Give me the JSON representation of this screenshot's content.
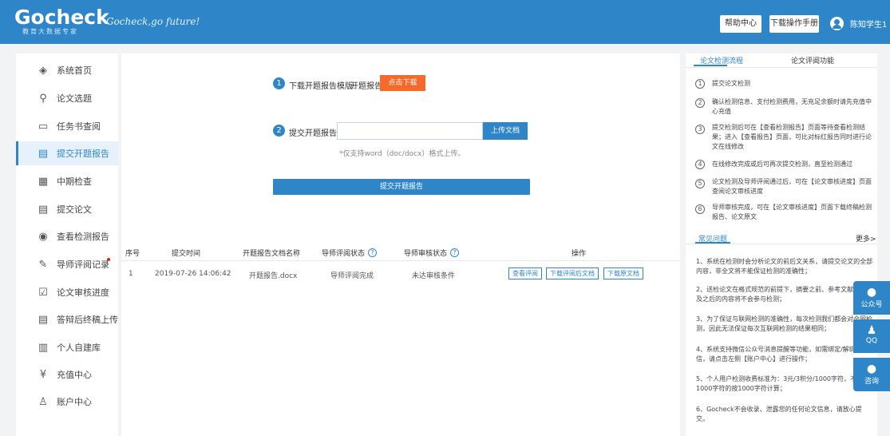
{
  "header": {
    "logo": "Gocheck",
    "logo_sub": "教育大数据专家",
    "slogan": "Gocheck,go future!",
    "help_label": "帮助中心",
    "manual_label": "下载操作手册",
    "user_name": "陈知学生1"
  },
  "sidebar": {
    "items": [
      {
        "label": "系统首页",
        "icon": "layers-icon",
        "glyph": "◈"
      },
      {
        "label": "论文选题",
        "icon": "search-icon",
        "glyph": "⚲"
      },
      {
        "label": "任务书查阅",
        "icon": "report-icon",
        "glyph": "▭"
      },
      {
        "label": "提交开题报告",
        "icon": "document-edit-icon",
        "glyph": "▤"
      },
      {
        "label": "中期检查",
        "icon": "table-icon",
        "glyph": "▦"
      },
      {
        "label": "提交论文",
        "icon": "document-submit-icon",
        "glyph": "▤"
      },
      {
        "label": "查看检测报告",
        "icon": "eye-icon",
        "glyph": "◉"
      },
      {
        "label": "导师评阅记录",
        "icon": "edit-icon",
        "glyph": "✎"
      },
      {
        "label": "论文审核进度",
        "icon": "clipboard-check-icon",
        "glyph": "☑"
      },
      {
        "label": "答辩后终稿上传",
        "icon": "document-upload-icon",
        "glyph": "▤"
      },
      {
        "label": "个人自建库",
        "icon": "library-icon",
        "glyph": "▥"
      },
      {
        "label": "充值中心",
        "icon": "yen-icon",
        "glyph": "¥"
      },
      {
        "label": "账户中心",
        "icon": "user-icon",
        "glyph": "♙"
      }
    ],
    "active_index": 3
  },
  "main": {
    "step1_num": "1",
    "step1_label": "下载开题报告模版:",
    "step1_file": "开题报告",
    "download_btn": "点击下载",
    "step2_num": "2",
    "step2_label": "提交开题报告:",
    "upload_btn": "上传文档",
    "hint": "*仅支持word（doc/docx）格式上传。",
    "submit_btn": "提交开题报告",
    "table": {
      "headers": [
        "序号",
        "提交时间",
        "开题报告文档名称",
        "导师评阅状态",
        "导师审核状态",
        "操作"
      ],
      "rows": [
        {
          "index": "1",
          "time": "2019-07-26 14:06:42",
          "name": "开题报告.docx",
          "review_status": "导师评阅完成",
          "audit_status": "未达审核条件",
          "actions": [
            "查看评阅",
            "下载评阅后文档",
            "下载原文档"
          ]
        }
      ]
    }
  },
  "right_panel": {
    "tabs": [
      "论文检测流程",
      "论文评阅功能"
    ],
    "active_tab": 0,
    "flow": [
      {
        "num": "1",
        "text": "提交论文检测"
      },
      {
        "num": "2",
        "text": "确认检测信息、支付检测费用，无充足余额时请先充值中心充值"
      },
      {
        "num": "3",
        "text": "提交检测后可在【查看检测报告】页面等待查看检测结果；进入【查看报告】页面，可比对标红报告同时进行论文在线修改"
      },
      {
        "num": "4",
        "text": "在线修改完成或后可再次提交检测，直至检测通过"
      },
      {
        "num": "5",
        "text": "论文检测及导师评阅通过后，可在【论文审核进度】页面查阅论文审核进度"
      },
      {
        "num": "6",
        "text": "导师审核完成，可在【论文审核进度】页面下载终稿检测报告、论文原文"
      }
    ],
    "faq_title": "常见问题",
    "more": "更多>",
    "faq": [
      "1、系统在检测时会分析论文的前后文关系，请提交论文的全部内容，非全文将不能保证检测的准确性；",
      "2、送检论文在格式规范的前提下，摘要之前、参考文献（含）及之后的内容将不会参与检测；",
      "3、为了保证与联网检测的准确性，每次检测我们都会对全网检测，因此无法保证每次互联网检测的结果相同；",
      "4、系统支持微信公众号消息提醒等功能，如需绑定/解绑微信，请点击左侧【账户中心】进行操作；",
      "5、个人用户检测收费标准为：3元/3积分/1000字符，不足1000字符的按1000字符计算；",
      "6、Gocheck不会收录、泄露您的任何论文信息，请放心提交。"
    ]
  },
  "float": {
    "wechat": "公众号",
    "qq": "QQ",
    "consult": "咨询"
  }
}
